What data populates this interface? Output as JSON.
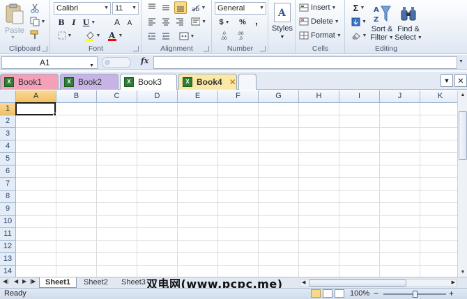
{
  "ribbon": {
    "clipboard": {
      "label": "Clipboard",
      "paste_label": "Paste"
    },
    "font": {
      "label": "Font",
      "font_name": "Calibri",
      "font_size": "11",
      "bold": "B",
      "italic": "I",
      "underline": "U",
      "grow": "A",
      "shrink": "A"
    },
    "alignment": {
      "label": "Alignment"
    },
    "number": {
      "label": "Number",
      "format": "General",
      "currency": "$",
      "percent": "%",
      "comma": ",",
      "inc_decimal": ".0 .00",
      "dec_decimal": ".00 .0"
    },
    "cells": {
      "label": "Cells",
      "insert": "Insert",
      "delete": "Delete",
      "format": "Format"
    },
    "styles": {
      "label": "Styles"
    },
    "editing": {
      "label": "Editing",
      "sort_line1": "Sort &",
      "sort_line2": "Filter",
      "find_line1": "Find &",
      "find_line2": "Select",
      "sum": "Σ"
    }
  },
  "formula_bar": {
    "name_box": "A1",
    "fx": "fx",
    "formula": ""
  },
  "workbook_tabs": [
    {
      "label": "Book1",
      "color": "#f4a0b8"
    },
    {
      "label": "Book2",
      "color": "#c7b3e6"
    },
    {
      "label": "Book3",
      "color": "#ffffff"
    },
    {
      "label": "Book4",
      "color": "#fbe8a6",
      "active": true,
      "close": "✕"
    }
  ],
  "grid": {
    "columns": [
      "A",
      "B",
      "C",
      "D",
      "E",
      "F",
      "G",
      "H",
      "I",
      "J",
      "K"
    ],
    "rows": [
      "1",
      "2",
      "3",
      "4",
      "5",
      "6",
      "7",
      "8",
      "9",
      "10",
      "11",
      "12",
      "13",
      "14"
    ],
    "active_cell": "A1"
  },
  "sheets": [
    {
      "label": "Sheet1",
      "active": true
    },
    {
      "label": "Sheet2"
    },
    {
      "label": "Sheet3"
    }
  ],
  "watermark": "双电网(www.pcpc.me)",
  "status": {
    "ready": "Ready",
    "zoom": "100%",
    "minus": "−",
    "plus": "+"
  },
  "colors": {
    "ribbon_bg": "#e9eff7",
    "selection_header": "#f1c15f",
    "excel_green": "#2e7d32"
  }
}
